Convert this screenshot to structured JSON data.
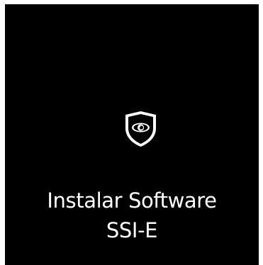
{
  "tile": {
    "label_line1": "Instalar Software",
    "label_line2": "SSI-E",
    "icon": "shield-eye-icon",
    "background": "#000000",
    "text_color": "#ffffff"
  }
}
